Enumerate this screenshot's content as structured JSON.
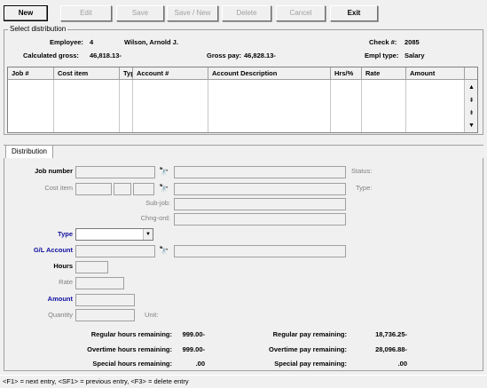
{
  "toolbar": {
    "new": "New",
    "edit": "Edit",
    "save": "Save",
    "save_new": "Save / New",
    "delete": "Delete",
    "cancel": "Cancel",
    "exit": "Exit"
  },
  "select_distribution": {
    "title": "Select distribution",
    "employee_label": "Employee:",
    "employee_id": "4",
    "employee_name": "Wilson, Arnold J.",
    "check_label": "Check #:",
    "check_number": "2085",
    "calc_gross_label": "Calculated gross:",
    "calc_gross": "46,818.13-",
    "gross_pay_label": "Gross pay:",
    "gross_pay": "46,828.13-",
    "empl_type_label": "Empl type:",
    "empl_type": "Salary"
  },
  "grid": {
    "columns": [
      "Job #",
      "Cost item",
      "Type",
      "Account #",
      "Account Description",
      "Hrs/%",
      "Rate",
      "Amount"
    ],
    "rows": []
  },
  "tabs": {
    "distribution": "Distribution"
  },
  "form": {
    "job_number_label": "Job number",
    "status_label": "Status:",
    "cost_item_label": "Cost item",
    "type_label_right": "Type:",
    "sub_job_label": "Sub-job:",
    "chng_ord_label": "Chng-ord:",
    "type_label": "Type",
    "gl_account_label": "G/L Account",
    "hours_label": "Hours",
    "rate_label": "Rate",
    "amount_label": "Amount",
    "quantity_label": "Quantity",
    "unit_label": "Unit:"
  },
  "summary": {
    "regular_hours_label": "Regular hours remaining:",
    "regular_hours": "999.00-",
    "overtime_hours_label": "Overtime hours remaining:",
    "overtime_hours": "999.00-",
    "special_hours_label": "Special hours remaining:",
    "special_hours": ".00",
    "regular_pay_label": "Regular pay remaining:",
    "regular_pay": "18,736.25-",
    "overtime_pay_label": "Overtime pay remaining:",
    "overtime_pay": "28,096.88-",
    "special_pay_label": "Special pay remaining:",
    "special_pay": ".00"
  },
  "statusbar": {
    "text": "<F1> = next entry, <SF1> = previous entry, <F3> = delete entry"
  }
}
